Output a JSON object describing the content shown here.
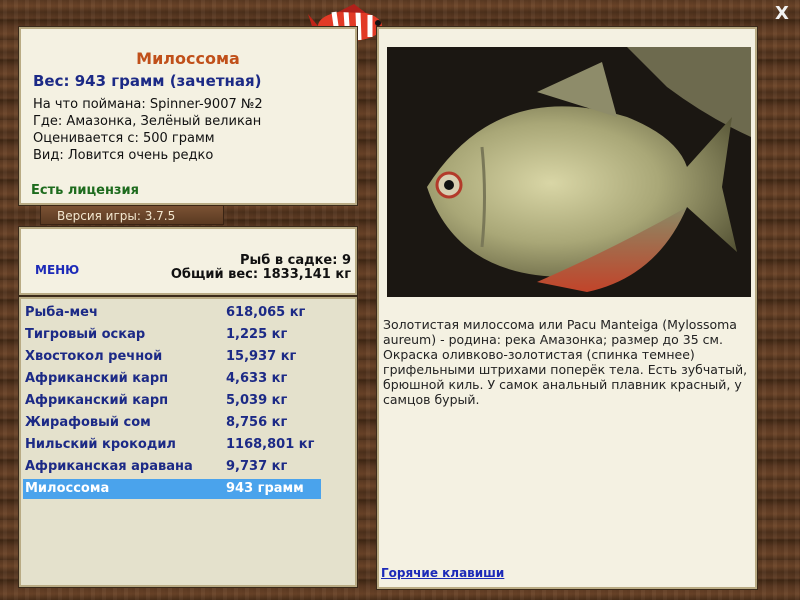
{
  "fish": {
    "name": "Милоссома",
    "weight": "Вес: 943 грамм (зачетная)",
    "caught_on": "На что поймана: Spinner-9007 №2",
    "location": "Где: Амазонка, Зелёный великан",
    "valued_from": "Оценивается с: 500 грамм",
    "rarity": "Вид: Ловится очень редко",
    "license": "Есть лицензия",
    "description": "Золотистая милоссома или Pacu Manteiga (Mylossoma aureum) - родина: река Амазонка; размер до 35 см. Окраска оливково-золотистая (спинка темнее) грифельными штрихами поперёк тела. Есть зубчатый, брюшной киль. У самок анальный плавник красный, у самцов бурый."
  },
  "version": "Версия игры: 3.7.5",
  "menu_label": "МЕНЮ",
  "stats": {
    "fish_in_keepnet": "Рыб в садке: 9",
    "total_weight": "Общий вес: 1833,141 кг"
  },
  "catch_list": [
    {
      "name": "Рыба-меч",
      "weight": "618,065 кг"
    },
    {
      "name": "Тигровый оскар",
      "weight": "1,225 кг"
    },
    {
      "name": "Хвостокол речной",
      "weight": "15,937 кг"
    },
    {
      "name": "Африканский карп",
      "weight": "4,633 кг"
    },
    {
      "name": "Африканский карп",
      "weight": "5,039 кг"
    },
    {
      "name": "Жирафовый сом",
      "weight": "8,756 кг"
    },
    {
      "name": "Нильский крокодил",
      "weight": "1168,801 кг"
    },
    {
      "name": "Африканская аравана",
      "weight": "9,737 кг"
    },
    {
      "name": "Милоссома",
      "weight": "943 грамм"
    }
  ],
  "selected_index": 8,
  "hotkeys_label": "Горячие клавиши",
  "close_label": "X",
  "colors": {
    "accent_title": "#c0501a",
    "list_text": "#1c2a86",
    "selection": "#4aa3ec",
    "license": "#1d6b1d"
  }
}
